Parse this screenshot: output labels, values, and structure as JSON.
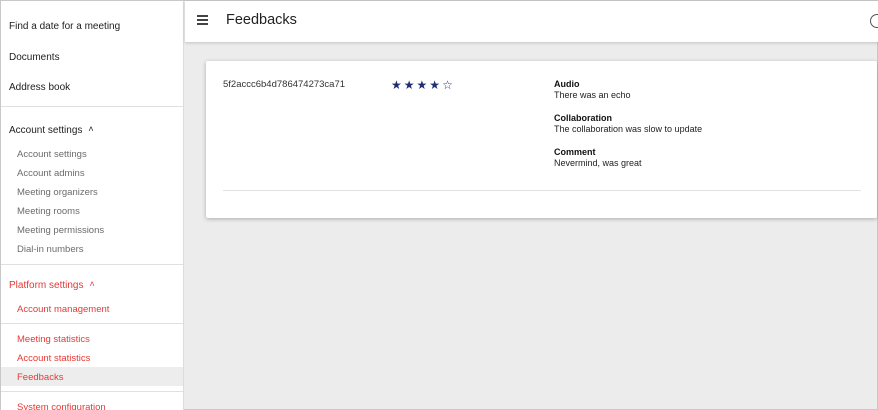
{
  "sidebar": {
    "find_date": "Find a date for a meeting",
    "documents": "Documents",
    "address_book": "Address book",
    "account_settings_header": "Account settings",
    "account_settings_items": [
      "Account settings",
      "Account admins",
      "Meeting organizers",
      "Meeting rooms",
      "Meeting permissions",
      "Dial-in numbers"
    ],
    "platform_settings_header": "Platform settings",
    "account_management": "Account management",
    "meeting_statistics": "Meeting statistics",
    "account_statistics": "Account statistics",
    "feedbacks": "Feedbacks",
    "system_configuration": "System configuration"
  },
  "header": {
    "title": "Feedbacks"
  },
  "feedback": {
    "id": "5f2accc6b4d786474273ca71",
    "rating": 4,
    "rating_max": 5,
    "fields": [
      {
        "label": "Audio",
        "value": "There was an echo"
      },
      {
        "label": "Collaboration",
        "value": "The collaboration was slow to update"
      },
      {
        "label": "Comment",
        "value": "Nevermind, was great"
      }
    ]
  },
  "colors": {
    "accent_red": "#e53935",
    "star_color": "#1f2f72"
  }
}
